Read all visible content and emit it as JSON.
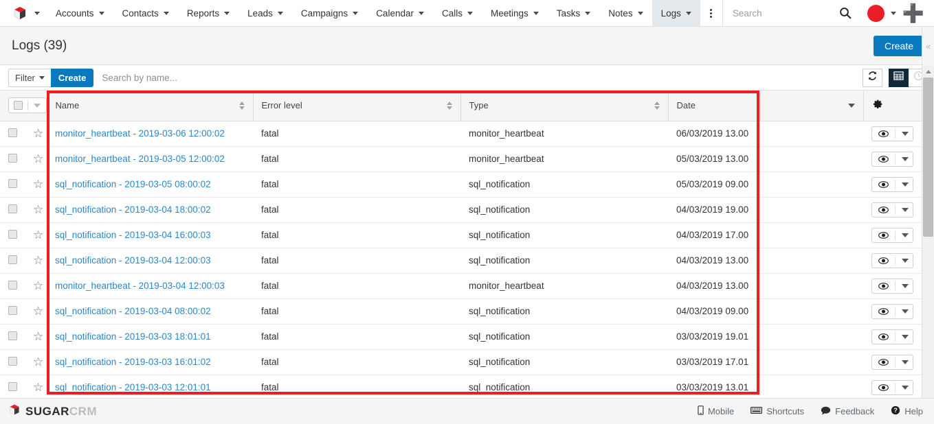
{
  "topnav": {
    "logo_icon": "sugar-cube-logo",
    "logo_caret_icon": "chevron-down-icon",
    "tabs": [
      {
        "label": "Accounts",
        "active": false
      },
      {
        "label": "Contacts",
        "active": false
      },
      {
        "label": "Reports",
        "active": false
      },
      {
        "label": "Leads",
        "active": false
      },
      {
        "label": "Campaigns",
        "active": false
      },
      {
        "label": "Calendar",
        "active": false
      },
      {
        "label": "Calls",
        "active": false
      },
      {
        "label": "Meetings",
        "active": false
      },
      {
        "label": "Tasks",
        "active": false
      },
      {
        "label": "Notes",
        "active": false
      },
      {
        "label": "Logs",
        "active": true
      }
    ],
    "more_icon": "kebab-menu-icon",
    "search_placeholder": "Search",
    "search_value": "",
    "search_icon": "search-icon",
    "avatar_icon": "user-avatar",
    "avatar_color": "#e81e26",
    "avatar_caret_icon": "chevron-down-icon",
    "add_icon": "plus-icon"
  },
  "pagehead": {
    "title": "Logs (39)",
    "create_label": "Create"
  },
  "filterbar": {
    "filter_label": "Filter",
    "filter_caret_icon": "chevron-down-icon",
    "create_label": "Create",
    "search_placeholder": "Search by name...",
    "search_value": "",
    "refresh_icon": "refresh-icon",
    "grid_view_icon": "grid-view-icon",
    "timeline_view_icon": "clock-icon"
  },
  "table": {
    "select_all_icon": "checkbox-unchecked",
    "select_all_caret_icon": "chevron-down-icon",
    "settings_icon": "gear-icon",
    "column_caret_icon": "chevron-down-icon",
    "row_view_icon": "eye-icon",
    "row_menu_icon": "chevron-down-icon",
    "star_icon": "star-outline-icon",
    "columns": [
      {
        "label": "Name",
        "sortable": true
      },
      {
        "label": "Error level",
        "sortable": true
      },
      {
        "label": "Type",
        "sortable": true
      },
      {
        "label": "Date",
        "sortable": false
      }
    ],
    "rows": [
      {
        "name": "monitor_heartbeat - 2019-03-06 12:00:02",
        "error_level": "fatal",
        "type": "monitor_heartbeat",
        "date": "06/03/2019 13.00"
      },
      {
        "name": "monitor_heartbeat - 2019-03-05 12:00:02",
        "error_level": "fatal",
        "type": "monitor_heartbeat",
        "date": "05/03/2019 13.00"
      },
      {
        "name": "sql_notification - 2019-03-05 08:00:02",
        "error_level": "fatal",
        "type": "sql_notification",
        "date": "05/03/2019 09.00"
      },
      {
        "name": "sql_notification - 2019-03-04 18:00:02",
        "error_level": "fatal",
        "type": "sql_notification",
        "date": "04/03/2019 19.00"
      },
      {
        "name": "sql_notification - 2019-03-04 16:00:03",
        "error_level": "fatal",
        "type": "sql_notification",
        "date": "04/03/2019 17.00"
      },
      {
        "name": "sql_notification - 2019-03-04 12:00:03",
        "error_level": "fatal",
        "type": "sql_notification",
        "date": "04/03/2019 13.00"
      },
      {
        "name": "monitor_heartbeat - 2019-03-04 12:00:03",
        "error_level": "fatal",
        "type": "monitor_heartbeat",
        "date": "04/03/2019 13.00"
      },
      {
        "name": "sql_notification - 2019-03-04 08:00:02",
        "error_level": "fatal",
        "type": "sql_notification",
        "date": "04/03/2019 09.00"
      },
      {
        "name": "sql_notification - 2019-03-03 18:01:01",
        "error_level": "fatal",
        "type": "sql_notification",
        "date": "03/03/2019 19.01"
      },
      {
        "name": "sql_notification - 2019-03-03 16:01:02",
        "error_level": "fatal",
        "type": "sql_notification",
        "date": "03/03/2019 17.01"
      },
      {
        "name": "sql_notification - 2019-03-03 12:01:01",
        "error_level": "fatal",
        "type": "sql_notification",
        "date": "03/03/2019 13.01"
      }
    ]
  },
  "rail": {
    "collapse_label": "«",
    "scroll_up_icon": "triangle-up-icon",
    "scroll_down_icon": "triangle-down-icon"
  },
  "footer": {
    "brand_primary": "SUGAR",
    "brand_secondary": "CRM",
    "links": [
      {
        "label": "Mobile",
        "icon": "mobile-icon"
      },
      {
        "label": "Shortcuts",
        "icon": "keyboard-icon"
      },
      {
        "label": "Feedback",
        "icon": "chat-bubble-icon"
      },
      {
        "label": "Help",
        "icon": "help-circle-icon"
      }
    ]
  },
  "annotation": {
    "color": "#ee1c25",
    "shape": "rectangle-highlight"
  }
}
